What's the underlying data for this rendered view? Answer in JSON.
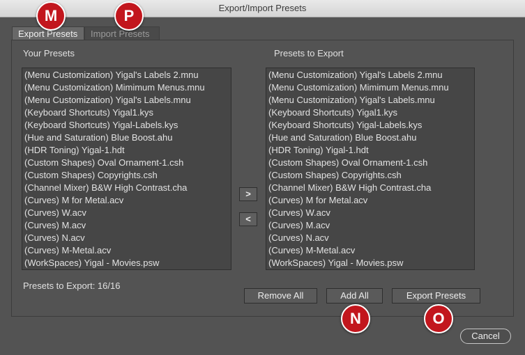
{
  "window": {
    "title": "Export/Import Presets"
  },
  "callouts": {
    "m": "M",
    "p": "P",
    "n": "N",
    "o": "O"
  },
  "tabs": [
    {
      "label": "Export Presets"
    },
    {
      "label": "Import Presets"
    }
  ],
  "left": {
    "heading": "Your Presets",
    "items": [
      "(Menu Customization)  Yigal's Labels 2.mnu",
      "(Menu Customization)  Mimimum Menus.mnu",
      "(Menu Customization)  Yigal's Labels.mnu",
      "(Keyboard Shortcuts)  Yigal1.kys",
      "(Keyboard Shortcuts)  Yigal-Labels.kys",
      "(Hue and Saturation)  Blue Boost.ahu",
      "(HDR Toning)  Yigal-1.hdt",
      "(Custom Shapes)  Oval Ornament-1.csh",
      "(Custom Shapes)  Copyrights.csh",
      "(Channel Mixer)  B&W High Contrast.cha",
      "(Curves)  M for Metal.acv",
      "(Curves)  W.acv",
      "(Curves)  M.acv",
      "(Curves)  N.acv",
      "(Curves)  M-Metal.acv",
      "(WorkSpaces)  Yigal - Movies.psw"
    ],
    "count_label": "Presets to Export: 16/16"
  },
  "right": {
    "heading": "Presets to Export",
    "items": [
      "(Menu Customization)  Yigal's Labels 2.mnu",
      "(Menu Customization)  Mimimum Menus.mnu",
      "(Menu Customization)  Yigal's Labels.mnu",
      "(Keyboard Shortcuts)  Yigal1.kys",
      "(Keyboard Shortcuts)  Yigal-Labels.kys",
      "(Hue and Saturation)  Blue Boost.ahu",
      "(HDR Toning)  Yigal-1.hdt",
      "(Custom Shapes)  Oval Ornament-1.csh",
      "(Custom Shapes)  Copyrights.csh",
      "(Channel Mixer)  B&W High Contrast.cha",
      "(Curves)  M for Metal.acv",
      "(Curves)  W.acv",
      "(Curves)  M.acv",
      "(Curves)  N.acv",
      "(Curves)  M-Metal.acv",
      "(WorkSpaces)  Yigal - Movies.psw"
    ]
  },
  "buttons": {
    "move_right": ">",
    "move_left": "<",
    "remove_all": "Remove All",
    "add_all": "Add All",
    "export_presets": "Export Presets",
    "cancel": "Cancel"
  },
  "colors": {
    "dialog_bg": "#535353",
    "list_bg": "#464646",
    "callout_red": "#c2161d"
  }
}
